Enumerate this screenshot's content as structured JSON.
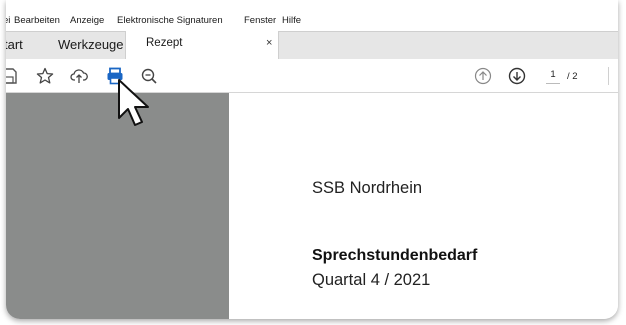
{
  "menu": {
    "items": [
      "ei",
      "Bearbeiten",
      "Anzeige",
      "Elektronische Signaturen",
      "Fenster",
      "Hilfe"
    ]
  },
  "tabs": {
    "home_label": "tart",
    "tools_label": "Werkzeuge",
    "active_label": "Rezept",
    "close_label": "×"
  },
  "toolbar": {
    "icons": [
      "save-icon",
      "star-icon",
      "cloud-upload-icon",
      "print-icon",
      "zoom-icon",
      "page-up-icon",
      "page-down-icon"
    ],
    "current_page": "1",
    "total_pages": "/ 2",
    "print_color": "#1a66c4"
  },
  "document": {
    "line1": "SSB Nordrhein",
    "line2": "Sprechstundenbedarf",
    "line3": "Quartal 4 / 2021"
  },
  "colors": {
    "sidebar": "#8a8c8b",
    "accent": "#1a6fd9"
  }
}
